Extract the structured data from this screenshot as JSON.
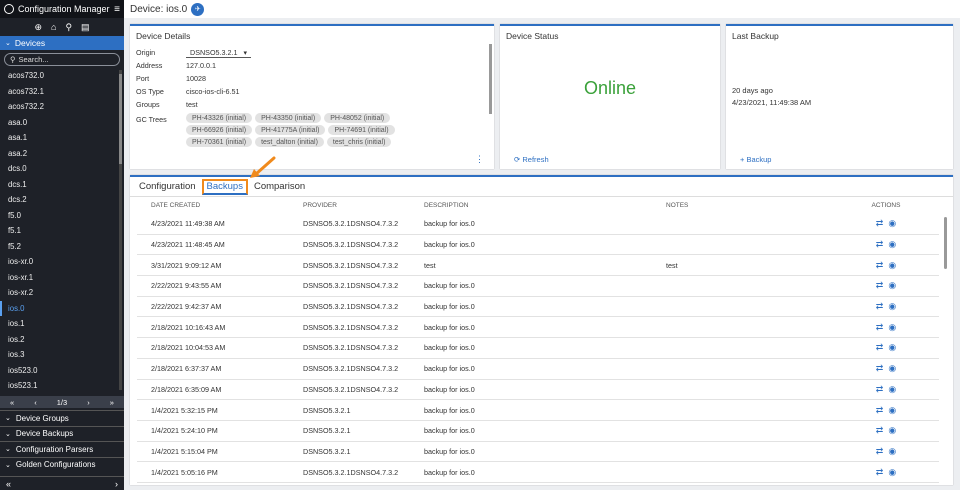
{
  "app": {
    "title": "Configuration Manager"
  },
  "sidebar": {
    "section_title": "Devices",
    "search_placeholder": "Search...",
    "devices": [
      "acos732.0",
      "acos732.1",
      "acos732.2",
      "asa.0",
      "asa.1",
      "asa.2",
      "dcs.0",
      "dcs.1",
      "dcs.2",
      "f5.0",
      "f5.1",
      "f5.2",
      "ios-xr.0",
      "ios-xr.1",
      "ios-xr.2",
      "ios.0",
      "ios.1",
      "ios.2",
      "ios.3",
      "ios523.0",
      "ios523.1"
    ],
    "active_device": "ios.0",
    "pager": {
      "first": "«",
      "prev": "‹",
      "page": "1/3",
      "next": "›",
      "last": "»"
    },
    "sections": [
      "Device Groups",
      "Device Backups",
      "Configuration Parsers",
      "Golden Configurations"
    ],
    "bottom": {
      "left": "«",
      "right": "›"
    }
  },
  "header": {
    "title": "Device: ios.0"
  },
  "details": {
    "title": "Device Details",
    "origin_label": "Origin",
    "origin_value": "DSNSO5.3.2.1",
    "address_label": "Address",
    "address_value": "127.0.0.1",
    "port_label": "Port",
    "port_value": "10028",
    "ostype_label": "OS Type",
    "ostype_value": "cisco-ios-cli-6.51",
    "groups_label": "Groups",
    "groups_value": "test",
    "gctrees_label": "GC Trees",
    "gctrees": [
      "PH-43326 (initial)",
      "PH-43350 (initial)",
      "PH-48052 (initial)",
      "PH-66926 (initial)",
      "PH-41775A (initial)",
      "PH-74691 (initial)",
      "PH-70361 (initial)",
      "test_dalton (initial)",
      "test_chris (initial)"
    ]
  },
  "status": {
    "title": "Device Status",
    "value": "Online",
    "action": "Refresh"
  },
  "last_backup": {
    "title": "Last Backup",
    "ago": "20 days ago",
    "date": "4/23/2021, 11:49:38 AM",
    "action": "+ Backup"
  },
  "tabs": [
    "Configuration",
    "Backups",
    "Comparison"
  ],
  "active_tab": "Backups",
  "table": {
    "headers": [
      "DATE CREATED",
      "PROVIDER",
      "DESCRIPTION",
      "NOTES",
      "ACTIONS"
    ],
    "rows": [
      [
        "4/23/2021 11:49:38 AM",
        "DSNSO5.3.2.1DSNSO4.7.3.2",
        "backup for ios.0",
        ""
      ],
      [
        "4/23/2021 11:48:45 AM",
        "DSNSO5.3.2.1DSNSO4.7.3.2",
        "backup for ios.0",
        ""
      ],
      [
        "3/31/2021 9:09:12 AM",
        "DSNSO5.3.2.1DSNSO4.7.3.2",
        "test",
        "test"
      ],
      [
        "2/22/2021 9:43:55 AM",
        "DSNSO5.3.2.1DSNSO4.7.3.2",
        "backup for ios.0",
        ""
      ],
      [
        "2/22/2021 9:42:37 AM",
        "DSNSO5.3.2.1DSNSO4.7.3.2",
        "backup for ios.0",
        ""
      ],
      [
        "2/18/2021 10:16:43 AM",
        "DSNSO5.3.2.1DSNSO4.7.3.2",
        "backup for ios.0",
        ""
      ],
      [
        "2/18/2021 10:04:53 AM",
        "DSNSO5.3.2.1DSNSO4.7.3.2",
        "backup for ios.0",
        ""
      ],
      [
        "2/18/2021 6:37:37 AM",
        "DSNSO5.3.2.1DSNSO4.7.3.2",
        "backup for ios.0",
        ""
      ],
      [
        "2/18/2021 6:35:09 AM",
        "DSNSO5.3.2.1DSNSO4.7.3.2",
        "backup for ios.0",
        ""
      ],
      [
        "1/4/2021 5:32:15 PM",
        "DSNSO5.3.2.1",
        "backup for ios.0",
        ""
      ],
      [
        "1/4/2021 5:24:10 PM",
        "DSNSO5.3.2.1",
        "backup for ios.0",
        ""
      ],
      [
        "1/4/2021 5:15:04 PM",
        "DSNSO5.3.2.1",
        "backup for ios.0",
        ""
      ],
      [
        "1/4/2021 5:05:16 PM",
        "DSNSO5.3.2.1DSNSO4.7.3.2",
        "backup for ios.0",
        ""
      ]
    ]
  },
  "colors": {
    "accent": "#2d6fc2",
    "online": "#3aa13a",
    "highlight": "#f08a1c"
  }
}
